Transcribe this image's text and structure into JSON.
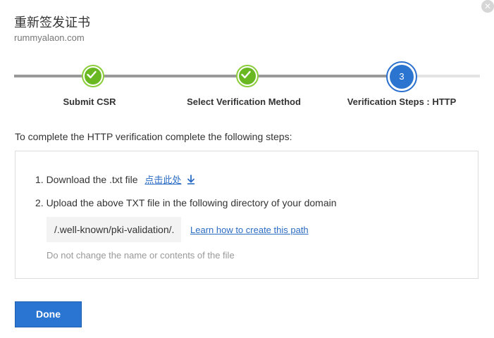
{
  "dialog": {
    "title": "重新签发证书",
    "domain": "rummyalaon.com",
    "close_icon": "close-icon"
  },
  "stepper": {
    "steps": [
      {
        "label": "Submit CSR",
        "status": "completed"
      },
      {
        "label": "Select Verification Method",
        "status": "completed"
      },
      {
        "label": "Verification Steps : HTTP",
        "status": "current",
        "number": "3"
      }
    ],
    "colors": {
      "completed": "#6ab821",
      "current": "#2b74d0",
      "track_done": "#999999",
      "track_todo": "#e3e3e3"
    }
  },
  "instructions": {
    "intro": "To complete the HTTP verification complete the following steps:",
    "step1_text": "1. Download the .txt file",
    "step1_link": "点击此处",
    "step2_text": "2. Upload the above TXT file in the following directory of your domain",
    "path": "/.well-known/pki-validation/.",
    "learn_link": "Learn how to create this path",
    "note": "Do not change the name or contents of the file"
  },
  "actions": {
    "done_label": "Done"
  }
}
